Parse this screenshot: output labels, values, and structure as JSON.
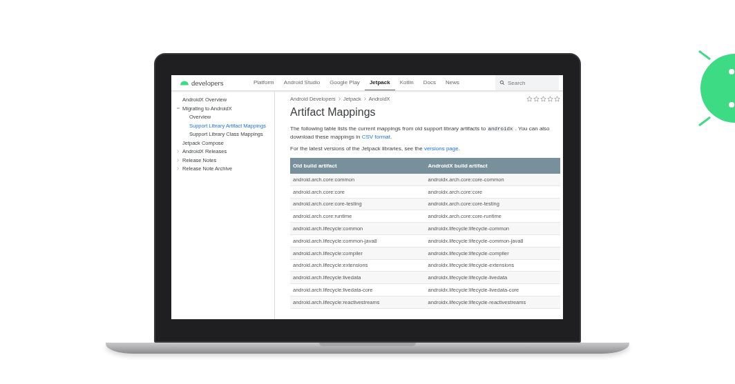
{
  "site": {
    "logo": "developers",
    "nav": [
      {
        "label": "Platform",
        "selected": false
      },
      {
        "label": "Android Studio",
        "selected": false
      },
      {
        "label": "Google Play",
        "selected": false
      },
      {
        "label": "Jetpack",
        "selected": true
      },
      {
        "label": "Kotlin",
        "selected": false
      },
      {
        "label": "Docs",
        "selected": false
      },
      {
        "label": "News",
        "selected": false
      }
    ],
    "search": {
      "placeholder": "Search"
    }
  },
  "sidebar": {
    "items": [
      {
        "label": "AndroidX Overview",
        "selected": false
      },
      {
        "label": "Migrating to AndroidX",
        "selected": false,
        "expanded": true,
        "children": [
          {
            "label": "Overview",
            "selected": false
          },
          {
            "label": "Support Library Artifact Mappings",
            "selected": true
          },
          {
            "label": "Support Library Class Mappings",
            "selected": false
          }
        ]
      },
      {
        "label": "Jetpack Compose",
        "selected": false
      },
      {
        "label": "AndroidX Releases",
        "selected": false,
        "expanded": false
      },
      {
        "label": "Release Notes",
        "selected": false,
        "expanded": false
      },
      {
        "label": "Release Note Archive",
        "selected": false,
        "expanded": false
      }
    ]
  },
  "breadcrumbs": [
    "Android Developers",
    "Jetpack",
    "AndroidX"
  ],
  "rating": {
    "stars": 0
  },
  "title": "Artifact Mappings",
  "paragraphs": [
    {
      "text": "The following table lists the current mappings from old support library artifacts to",
      "code": "androidx",
      "after": ". You can also download these mappings in",
      "link": "CSV format",
      "end": "."
    },
    {
      "text": "For the latest versions of the Jetpack libraries, see the",
      "link": "versions page",
      "end": "."
    }
  ],
  "table": {
    "columns": [
      "Old build artifact",
      "AndroidX build artifact"
    ],
    "rows": [
      [
        "android.arch.core:common",
        "androidx.arch.core:core-common"
      ],
      [
        "android.arch.core:core",
        "androidx.arch.core:core"
      ],
      [
        "android.arch.core:core-testing",
        "androidx.arch.core:core-testing"
      ],
      [
        "android.arch.core:runtime",
        "androidx.arch.core:core-runtime"
      ],
      [
        "android.arch.lifecycle:common",
        "androidx.lifecycle:lifecycle-common"
      ],
      [
        "android.arch.lifecycle:common-java8",
        "androidx.lifecycle:lifecycle-common-java8"
      ],
      [
        "android.arch.lifecycle:compiler",
        "androidx.lifecycle:lifecycle-compiler"
      ],
      [
        "android.arch.lifecycle:extensions",
        "androidx.lifecycle:lifecycle-extensions"
      ],
      [
        "android.arch.lifecycle:livedata",
        "androidx.lifecycle:lifecycle-livedata"
      ],
      [
        "android.arch.lifecycle:livedata-core",
        "androidx.lifecycle:lifecycle-livedata-core"
      ],
      [
        "android.arch.lifecycle:reactivestreams",
        "androidx.lifecycle:lifecycle-reactivestreams"
      ]
    ]
  }
}
